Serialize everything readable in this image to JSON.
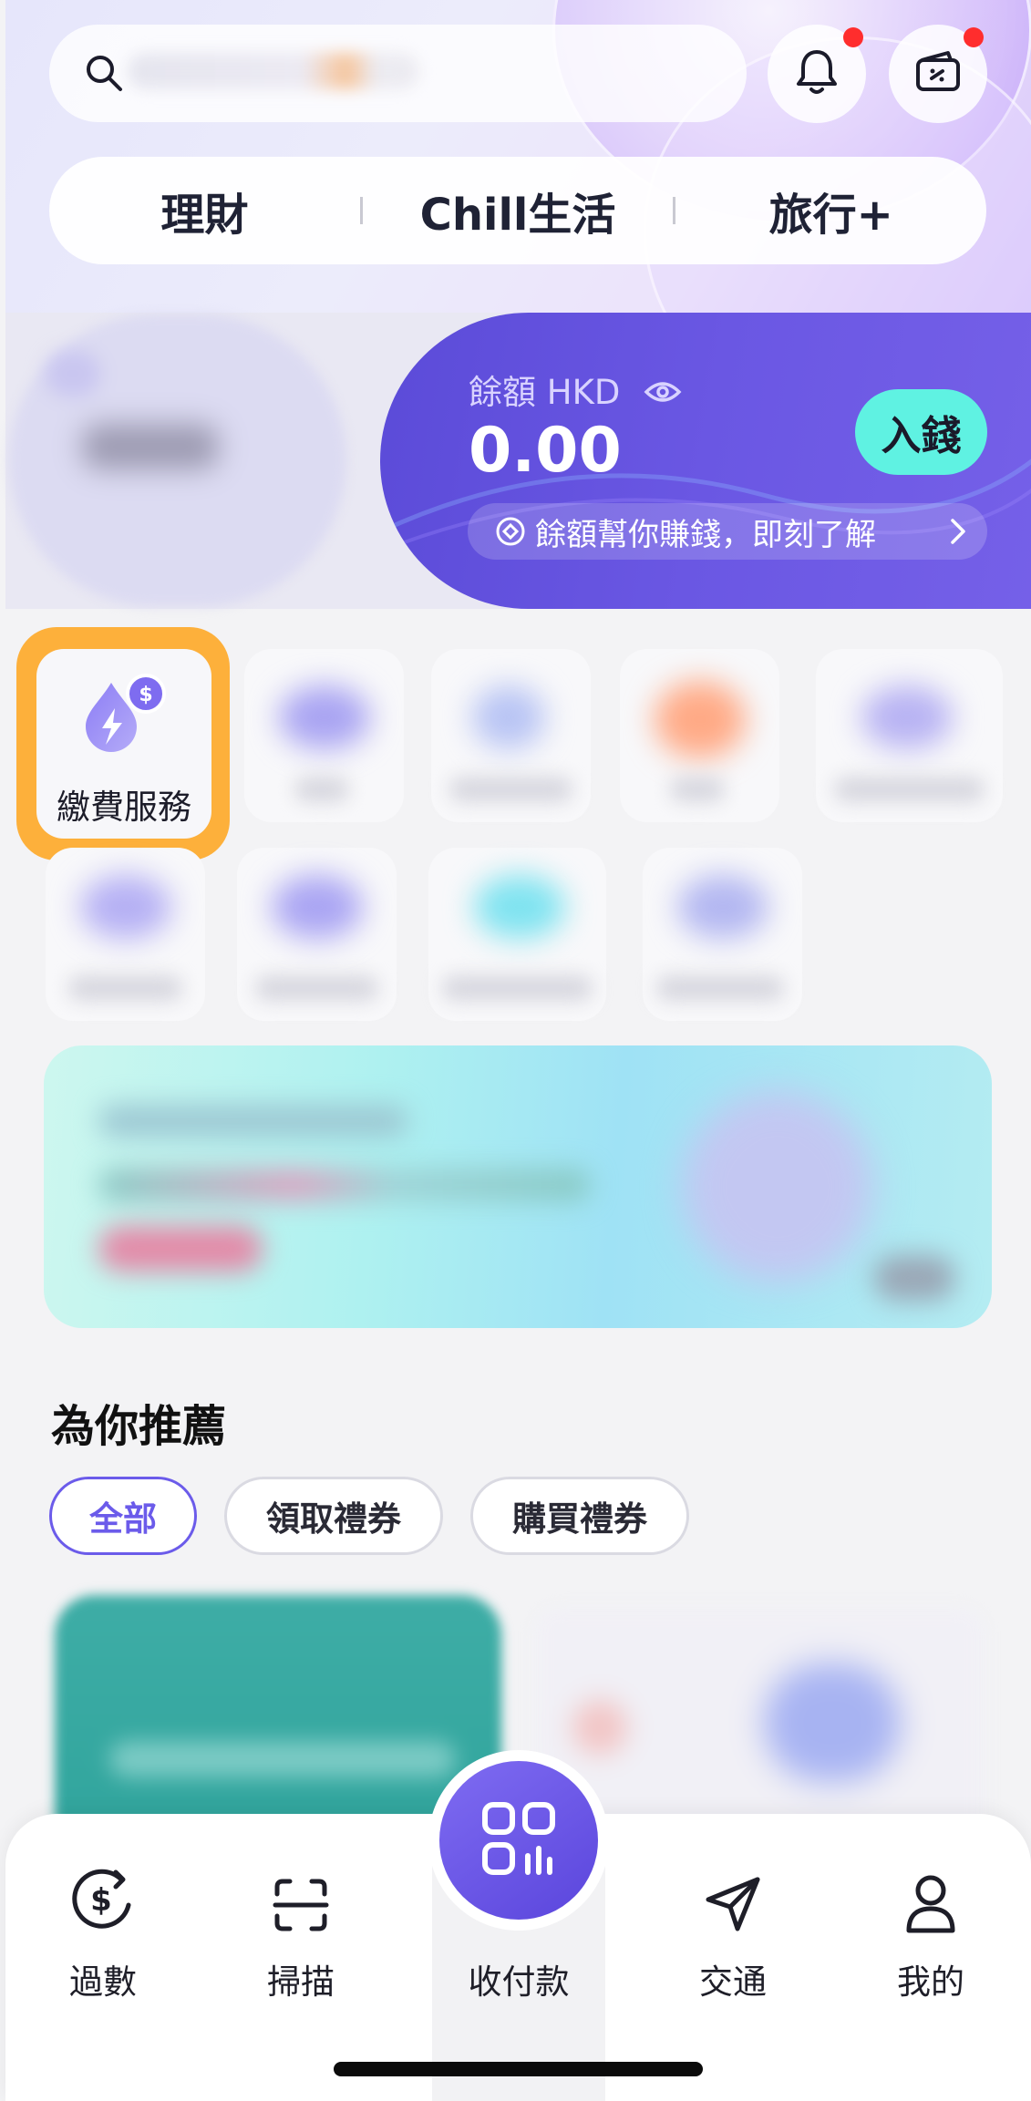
{
  "search": {
    "placeholder": ""
  },
  "header": {
    "tabs": [
      {
        "label": "理財"
      },
      {
        "label": "Chill生活"
      },
      {
        "label": "旅行+"
      }
    ]
  },
  "balance": {
    "label": "餘額 HKD",
    "amount": "0.00",
    "deposit_label": "入錢",
    "promo_text": "餘額幫你賺錢，即刻了解"
  },
  "services": {
    "highlighted": {
      "label": "繳費服務",
      "icon": "bill-payment-icon"
    }
  },
  "recommend": {
    "title": "為你推薦",
    "chips": [
      {
        "label": "全部",
        "active": true
      },
      {
        "label": "領取禮券",
        "active": false
      },
      {
        "label": "購買禮券",
        "active": false
      }
    ]
  },
  "bottom_nav": {
    "items": [
      {
        "label": "過數",
        "icon": "transfer-icon"
      },
      {
        "label": "掃描",
        "icon": "scan-icon"
      },
      {
        "label": "收付款",
        "icon": "qr-pay-icon"
      },
      {
        "label": "交通",
        "icon": "transport-icon"
      },
      {
        "label": "我的",
        "icon": "profile-icon"
      }
    ]
  },
  "colors": {
    "accent": "#6b5bea",
    "deposit_button": "#5ff2e2",
    "highlight_border": "#fdb03b",
    "notification_dot": "#ff2d2d"
  }
}
